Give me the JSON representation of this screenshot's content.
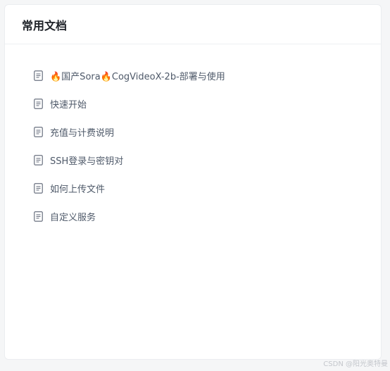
{
  "panel": {
    "title": "常用文档"
  },
  "docs": [
    {
      "label": "🔥国产Sora🔥CogVideoX-2b-部署与使用",
      "icon": "document-icon"
    },
    {
      "label": "快速开始",
      "icon": "document-icon"
    },
    {
      "label": "充值与计费说明",
      "icon": "document-icon"
    },
    {
      "label": "SSH登录与密钥对",
      "icon": "document-icon"
    },
    {
      "label": "如何上传文件",
      "icon": "document-icon"
    },
    {
      "label": "自定义服务",
      "icon": "document-icon"
    }
  ],
  "watermark": "CSDN @阳光奥特曼",
  "colors": {
    "title": "#1f2329",
    "link": "#4e5969",
    "icon": "#6b7280"
  }
}
